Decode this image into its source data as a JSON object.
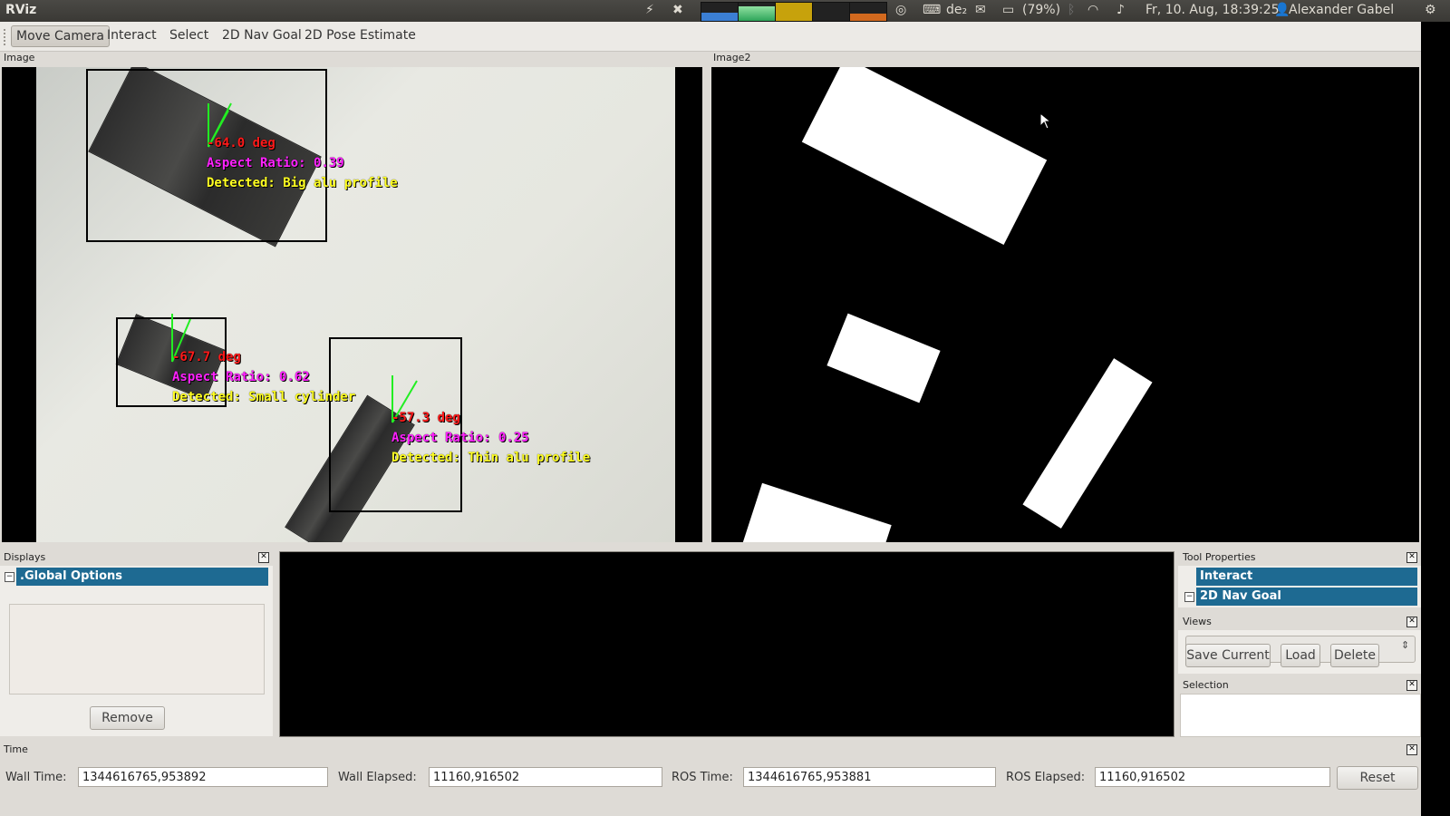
{
  "topbar": {
    "app_name": "RViz",
    "keyboard_layout": "de₂",
    "battery": "(79%)",
    "datetime": "Fr, 10. Aug, 18:39:25",
    "user": "Alexander Gabel"
  },
  "toolbar": {
    "tools": [
      "Move Camera",
      "Interact",
      "Select",
      "2D Nav Goal",
      "2D Pose Estimate"
    ],
    "active": "Move Camera"
  },
  "image_panel": {
    "title": "Image",
    "detections": [
      {
        "angle": "-64.0 deg",
        "aspect": "Aspect Ratio: 0.39",
        "detected": "Detected: Big alu profile"
      },
      {
        "angle": "-67.7 deg",
        "aspect": "Aspect Ratio: 0.62",
        "detected": "Detected: Small cylinder"
      },
      {
        "angle": "-57.3 deg",
        "aspect": "Aspect Ratio: 0.25",
        "detected": "Detected: Thin alu profile"
      }
    ]
  },
  "image2_panel": {
    "title": "Image2"
  },
  "displays": {
    "title": "Displays",
    "selected_item": ".Global Options",
    "remove_label": "Remove"
  },
  "tool_properties": {
    "title": "Tool Properties",
    "items": [
      "Interact",
      "2D Nav Goal"
    ]
  },
  "views": {
    "title": "Views",
    "buttons": [
      "Save Current",
      "Load",
      "Delete"
    ]
  },
  "selection": {
    "title": "Selection"
  },
  "time": {
    "title": "Time",
    "wall_time_label": "Wall Time:",
    "wall_time": "1344616765,953892",
    "wall_elapsed_label": "Wall Elapsed:",
    "wall_elapsed": "11160,916502",
    "ros_time_label": "ROS Time:",
    "ros_time": "1344616765,953881",
    "ros_elapsed_label": "ROS Elapsed:",
    "ros_elapsed": "11160,916502",
    "reset_label": "Reset"
  },
  "colors": {
    "selection_blue": "#1e6a92",
    "label_red": "#ff1a1a",
    "label_magenta": "#ff22ff",
    "label_yellow": "#ffff22"
  }
}
